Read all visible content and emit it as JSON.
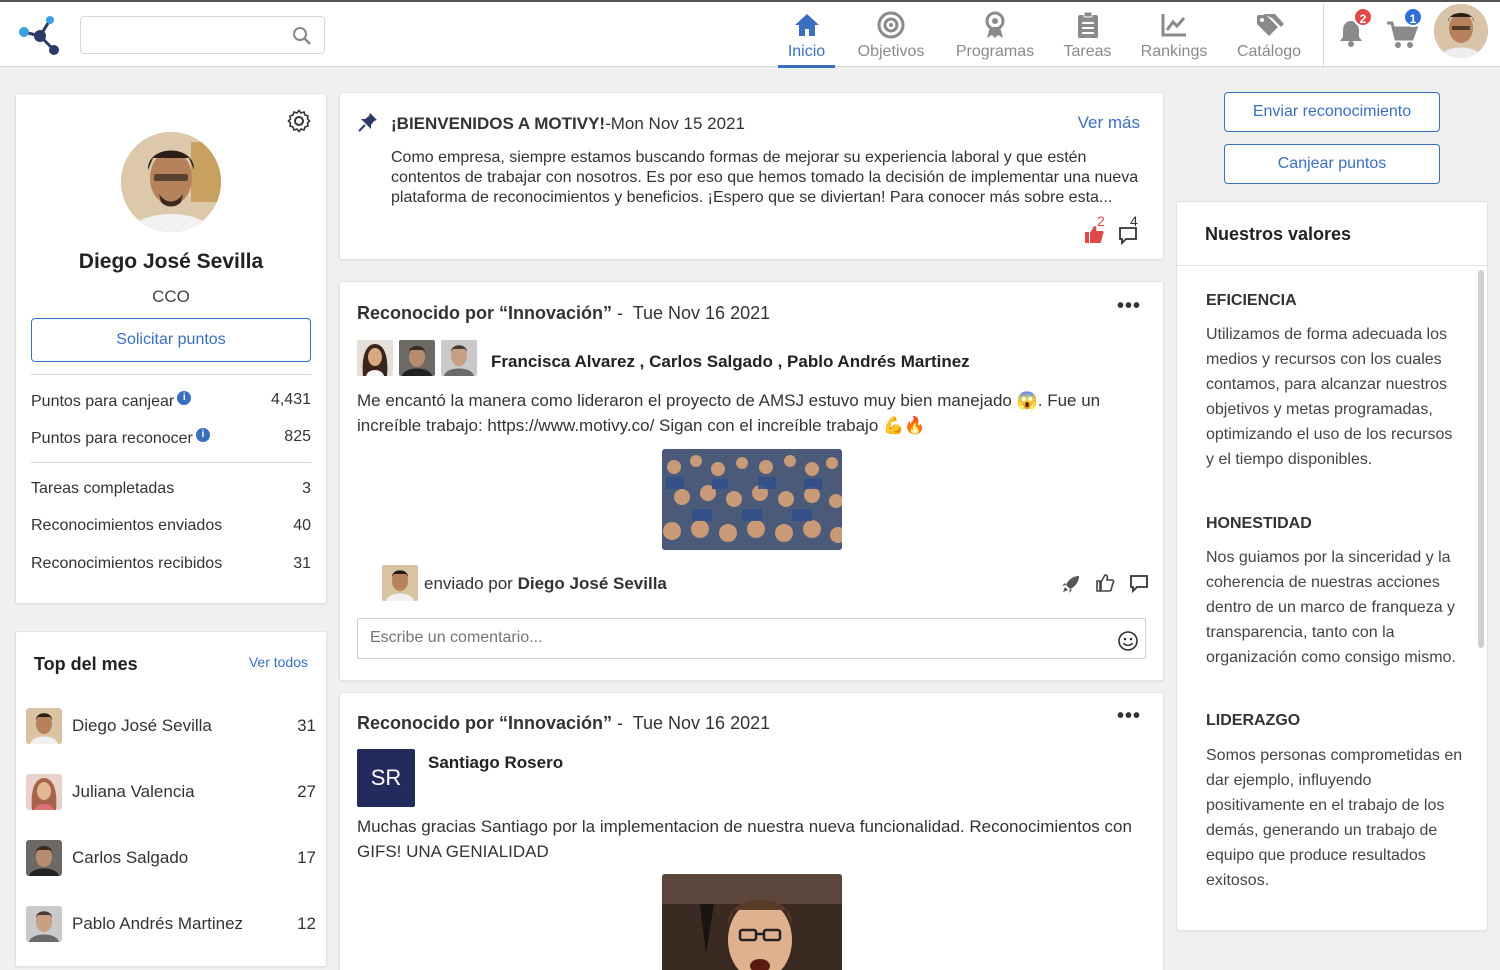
{
  "nav": {
    "search_placeholder": "",
    "items": [
      {
        "label": "Inicio",
        "icon": "home-icon",
        "active": true
      },
      {
        "label": "Objetivos",
        "icon": "target-icon",
        "active": false
      },
      {
        "label": "Programas",
        "icon": "award-icon",
        "active": false
      },
      {
        "label": "Tareas",
        "icon": "clipboard-icon",
        "active": false
      },
      {
        "label": "Rankings",
        "icon": "chart-icon",
        "active": false
      },
      {
        "label": "Catálogo",
        "icon": "tag-icon",
        "active": false
      }
    ],
    "notifications_count": "2",
    "cart_count": "1"
  },
  "profile": {
    "name": "Diego José Sevilla",
    "role": "CCO",
    "request_points_label": "Solicitar puntos",
    "stats": [
      {
        "label": "Puntos para canjear",
        "value": "4,431"
      },
      {
        "label": "Puntos para reconocer",
        "value": "825"
      },
      {
        "label": "Tareas completadas",
        "value": "3"
      },
      {
        "label": "Reconocimientos enviados",
        "value": "40"
      },
      {
        "label": "Reconocimientos recibidos",
        "value": "31"
      }
    ]
  },
  "top_month": {
    "title": "Top del mes",
    "see_all": "Ver todos",
    "rows": [
      {
        "name": "Diego José Sevilla",
        "score": "31"
      },
      {
        "name": "Juliana Valencia",
        "score": "27"
      },
      {
        "name": "Carlos Salgado",
        "score": "17"
      },
      {
        "name": "Pablo Andrés Martinez",
        "score": "12"
      }
    ]
  },
  "announcement": {
    "title": "¡BIENVENIDOS A MOTIVY!",
    "date": "-Mon Nov 15 2021",
    "see_more": "Ver más",
    "body": "Como empresa, siempre estamos buscando formas de mejorar su experiencia laboral y que estén contentos de trabajar con nosotros. Es por eso que hemos tomado la decisión de implementar una nueva plataforma de reconocimientos y beneficios. ¡Espero que se diviertan! Para conocer más sobre esta...",
    "likes": "2",
    "comments": "4"
  },
  "posts": [
    {
      "title_prefix": "Reconocido por “Innovación”",
      "date": " -  Tue Nov 16 2021",
      "recipients": "Francisca Alvarez , Carlos Salgado , Pablo Andrés Martinez",
      "body": "Me encantó la manera como lideraron el proyecto de AMSJ estuvo muy bien manejado 😱. Fue un increíble trabajo: https://www.motivy.co/ Sigan con el increíble trabajo 💪🔥",
      "sent_by_label": "enviado por",
      "sender": "Diego José Sevilla",
      "comment_placeholder": "Escribe un comentario..."
    },
    {
      "title_prefix": "Reconocido por “Innovación”",
      "date": " -  Tue Nov 16 2021",
      "recipient_initials": "SR",
      "recipients": "Santiago Rosero",
      "body": "Muchas gracias Santiago por la implementacion de nuestra nueva funcionalidad. Reconocimientos con GIFS! UNA GENIALIDAD"
    }
  ],
  "actions": {
    "send_recognition": "Enviar reconocimiento",
    "redeem_points": "Canjear puntos"
  },
  "values": {
    "title": "Nuestros valores",
    "items": [
      {
        "name": "EFICIENCIA",
        "text": "Utilizamos de forma adecuada los medios y recursos con los cuales contamos, para alcanzar nuestros objetivos y metas programadas, optimizando el uso de los recursos y el tiempo disponibles."
      },
      {
        "name": "HONESTIDAD",
        "text": "Nos guiamos por la sinceridad y la coherencia de nuestras acciones dentro de un marco de franqueza y transparencia, tanto con la organización como consigo mismo."
      },
      {
        "name": "LIDERAZGO",
        "text": "Somos personas comprometidas en dar ejemplo, influyendo positivamente en el trabajo de los demás, generando un trabajo de equipo que produce resultados exitosos."
      }
    ]
  },
  "colors": {
    "accent": "#3a6fc0",
    "badge_red": "#e04848",
    "badge_blue": "#2f6fd6",
    "navy_avatar": "#232a5c"
  }
}
